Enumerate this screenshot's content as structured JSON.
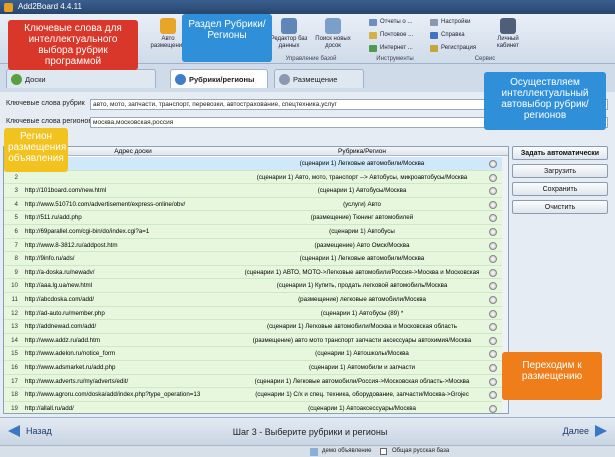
{
  "window": {
    "title": "Add2Board 4.4.11"
  },
  "ribbon": {
    "big_buttons": [
      {
        "label": "Авто размещение",
        "color": "#e7a52a"
      },
      {
        "label": "Редактор баз данных",
        "color": "#5f86b8"
      },
      {
        "label": "Поиск новых досок",
        "color": "#7aa0c9"
      },
      {
        "label": "Личный кабинет",
        "color": "#4f5f79"
      }
    ],
    "small_buttons": [
      {
        "label": "Отчеты о ...",
        "color": "#6b8fc0"
      },
      {
        "label": "Почтовое ...",
        "color": "#d4b04a"
      },
      {
        "label": "Интернет ...",
        "color": "#4e9a4e"
      },
      {
        "label": "Настройки",
        "color": "#8a99ad"
      },
      {
        "label": "Справка",
        "color": "#3f74c0"
      },
      {
        "label": "Регистрация",
        "color": "#c9a43a"
      }
    ],
    "groups": [
      "Управление базой",
      "Инструменты",
      "Сервис"
    ]
  },
  "tabs": [
    {
      "label": "Доски",
      "color": "#59a043"
    },
    {
      "label": "Рубрики/регионы",
      "color": "#3f7fc8"
    },
    {
      "label": "Размещение",
      "color": "#8b9ab0"
    }
  ],
  "form": {
    "keywords_label": "Ключевые слова рубрик",
    "keywords_value": "авто, мото, запчасти, транспорт, перевозки, автострахование, спецтехника,услуг",
    "regions_label": "Ключевые слова регионов",
    "regions_value": "москва,московская,россия"
  },
  "grid": {
    "headers": [
      "Адрес доски",
      "Рубрика/Регион"
    ],
    "rows": [
      {
        "n": "1",
        "url": "",
        "cat": "(сценарии 1) Легковые автомобили/Москва"
      },
      {
        "n": "2",
        "url": "",
        "cat": "(сценарии 1) Авто, мото, транспорт --> Автобусы, микроавтобусы/Москва"
      },
      {
        "n": "3",
        "url": "http://101board.com/new.html",
        "cat": "(сценарии 1) Автобусы/Москва"
      },
      {
        "n": "4",
        "url": "http://www.510710.com/advertisement/express-online/obv/",
        "cat": "(услуги) Авто"
      },
      {
        "n": "5",
        "url": "http://511.ru/add.php",
        "cat": "(размещение) Тюнинг автомобилей"
      },
      {
        "n": "6",
        "url": "http://69parallel.com/cgi-bin/do/index.cgi?a=1",
        "cat": "(сценарии 1) Автобусы"
      },
      {
        "n": "7",
        "url": "http://www.8-3812.ru/addpost.htm",
        "cat": "(размещение) Авто Омск/Москва"
      },
      {
        "n": "8",
        "url": "http://9info.ru/ads/",
        "cat": "(сценарии 1) Легковые автомобили/Москва"
      },
      {
        "n": "9",
        "url": "http://a-doska.ru/newadv/",
        "cat": "(сценарии 1) АВТО, МОТО->Легковые автомобили/Россия->Москва и Московская"
      },
      {
        "n": "10",
        "url": "http://aaa.lg.ua/new.html",
        "cat": "(сценарии 1) Купить, продать легковой автомобиль/Москва"
      },
      {
        "n": "11",
        "url": "http://abcdoska.com/add/",
        "cat": "(размещение) легковые автомобили/Москва"
      },
      {
        "n": "12",
        "url": "http://ad-auto.ru/member.php",
        "cat": "(сценарии 1) Автобусы (89) *"
      },
      {
        "n": "13",
        "url": "http://addnewad.com/add/",
        "cat": "(сценарии 1) Легковые автомобили/Москва и Московская область"
      },
      {
        "n": "14",
        "url": "http://www.addz.ru/add.htm",
        "cat": "(размещение) авто мото транспорт запчасти аксессуары автохимия/Москва"
      },
      {
        "n": "15",
        "url": "http://www.adelon.ru/notice_form",
        "cat": "(сценарии 1)        Автошколы/Москва"
      },
      {
        "n": "16",
        "url": "http://www.adsmarket.ru/add.php",
        "cat": "(сценарии 1) Автомобили и запчасти"
      },
      {
        "n": "17",
        "url": "http://www.adverts.ru/my/adverts/edit/",
        "cat": "(сценарии 1) Легковые автомобили/Россия->Московская область->Москва"
      },
      {
        "n": "18",
        "url": "http://www.agroru.com/doska/add/index.php?type_operation=13",
        "cat": "(сценарии 1) С/х и спец. техника, оборудование, запчасти/Москва->Grojec"
      },
      {
        "n": "19",
        "url": "http://allall.ru/add/",
        "cat": "(сценарии 1)        Автоаксессуары/Москва"
      }
    ]
  },
  "actions": {
    "auto": "Задать автоматически",
    "load": "Загрузить",
    "save": "Сохранить",
    "clear": "Очистить"
  },
  "bottom": {
    "back": "Назад",
    "step": "Шаг 3 - Выберите рубрики и регионы",
    "next": "Далее"
  },
  "status": {
    "demo": "демо объявление",
    "base": "Общая русская база"
  },
  "callouts": [
    {
      "text": "Ключевые слова для интеллектуального выбора рубрик программой",
      "color": "#d9372a"
    },
    {
      "text": "Раздел Рубрики/ Регионы",
      "color": "#2f8fd8"
    },
    {
      "text": "Осуществляем интеллектуальный автовыбор рубрик/регионов",
      "color": "#2f8fd8"
    },
    {
      "text": "Регион размещения объявления",
      "color": "#f2c21e"
    },
    {
      "text": "Переходим к размещению",
      "color": "#ef7d1a"
    }
  ]
}
